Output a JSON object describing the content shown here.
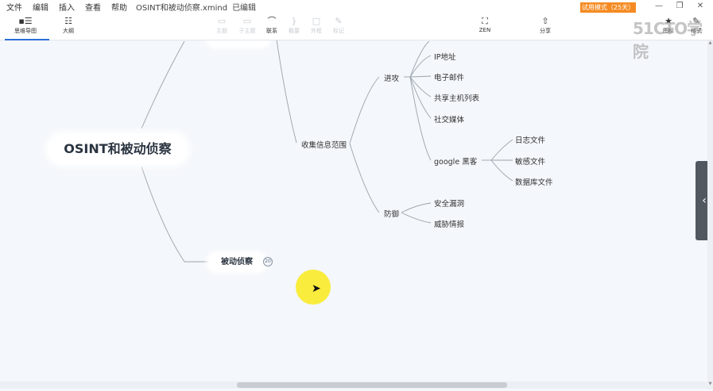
{
  "menu": {
    "items": [
      "文件",
      "编辑",
      "插入",
      "查看",
      "帮助"
    ],
    "doc_title": "OSINT和被动侦察.xmind",
    "save_status": "已编辑"
  },
  "trial_badge": "试用模式（25天）",
  "window_controls": {
    "minimize": "—",
    "restore": "❐",
    "close": "✕"
  },
  "view_tabs": [
    {
      "label": "思维导图",
      "icon": "mindmap-icon",
      "active": true
    },
    {
      "label": "大纲",
      "icon": "outline-icon",
      "active": false
    }
  ],
  "toolbar": {
    "topic": "主题",
    "subtopic": "子主题",
    "relationship": "联系",
    "summary": "概要",
    "boundary": "外框",
    "labels": "标记",
    "zen": "ZEN",
    "share": "分享",
    "icons": "图标",
    "format": "格式"
  },
  "watermark": "51CTO学院",
  "mindmap": {
    "central": "OSINT和被动侦察",
    "passive_recon": "被动侦察",
    "collect_scope": "收集信息范围",
    "attack": "进攻",
    "attack_items": [
      "IP地址",
      "电子邮件",
      "共享主机列表",
      "社交媒体",
      "google 黑客"
    ],
    "google_items": [
      "日志文件",
      "敏感文件",
      "数据库文件"
    ],
    "defense": "防御",
    "defense_items": [
      "安全漏洞",
      "威胁情报"
    ]
  },
  "collapse_badge": "20",
  "colors": {
    "accent": "#2b6fd6",
    "trial_orange": "#f58b22",
    "canvas_bg": "#f4f7fb",
    "line": "#9aa3ad",
    "cursor_halo": "#f8e61c"
  }
}
